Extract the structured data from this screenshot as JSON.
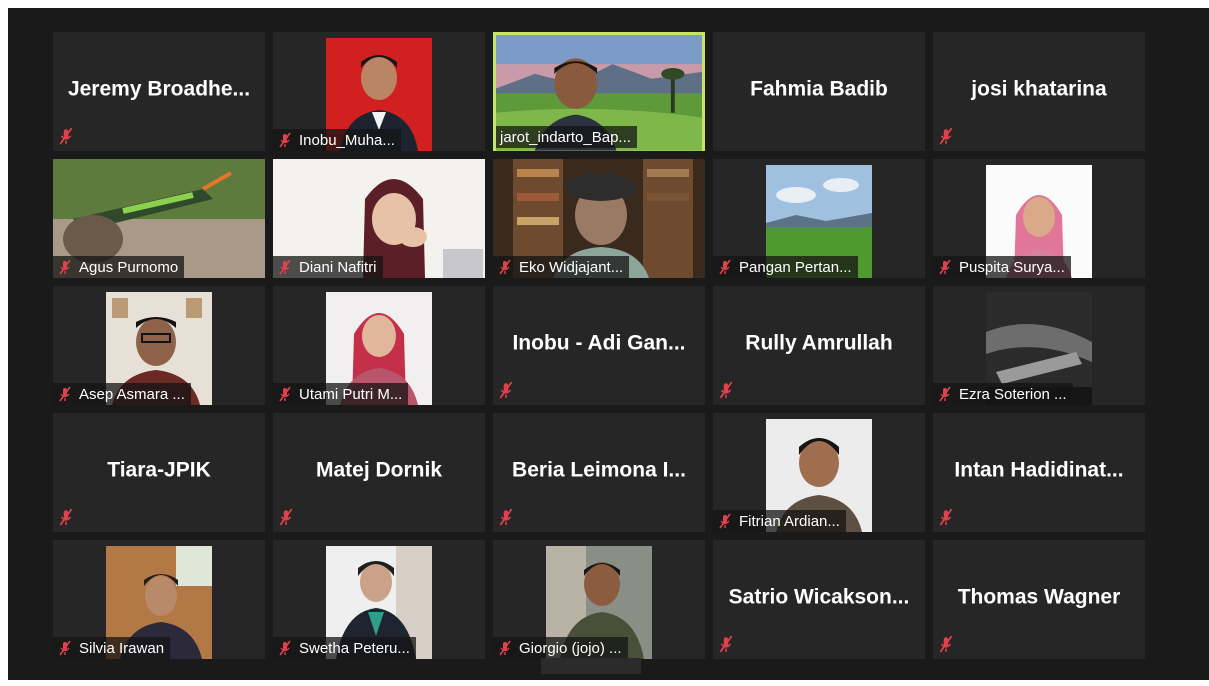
{
  "participants": [
    {
      "name": "Jeremy  Broadhe...",
      "video": false
    },
    {
      "name": "Inobu_Muha...",
      "video": true
    },
    {
      "name": "jarot_indarto_Bap...",
      "video": true,
      "active": true
    },
    {
      "name": "Fahmia Badib",
      "video": false
    },
    {
      "name": "josi khatarina",
      "video": false
    },
    {
      "name": "Agus Purnomo",
      "video": true
    },
    {
      "name": "Diani Nafitri",
      "video": true
    },
    {
      "name": "Eko Widjajant...",
      "video": true
    },
    {
      "name": "Pangan Pertan...",
      "video": true
    },
    {
      "name": "Puspita Surya...",
      "video": true
    },
    {
      "name": "Asep Asmara ...",
      "video": true
    },
    {
      "name": "Utami Putri M...",
      "video": true
    },
    {
      "name": "Inobu  -  Adi Gan...",
      "video": false
    },
    {
      "name": "Rully Amrullah",
      "video": false
    },
    {
      "name": "Ezra Soterion ...",
      "video": true
    },
    {
      "name": "Tiara-JPIK",
      "video": false
    },
    {
      "name": "Matej Dornik",
      "video": false
    },
    {
      "name": "Beria  Leimona  I...",
      "video": false
    },
    {
      "name": "Fitrian Ardian...",
      "video": true
    },
    {
      "name": "Intan  Hadidinat...",
      "video": false
    },
    {
      "name": "Silvia Irawan",
      "video": true
    },
    {
      "name": "Swetha Peteru...",
      "video": true
    },
    {
      "name": "Giorgio (jojo) ...",
      "video": true
    },
    {
      "name": "Satrio  Wicakson...",
      "video": false
    },
    {
      "name": "Thomas Wagner",
      "video": false
    }
  ],
  "colors": {
    "background": "#1a1a1a",
    "tile": "#262626",
    "active_border": "#c6e36b",
    "mute_icon": "#e0414c"
  },
  "icons": {
    "mute": "microphone-muted-icon"
  }
}
